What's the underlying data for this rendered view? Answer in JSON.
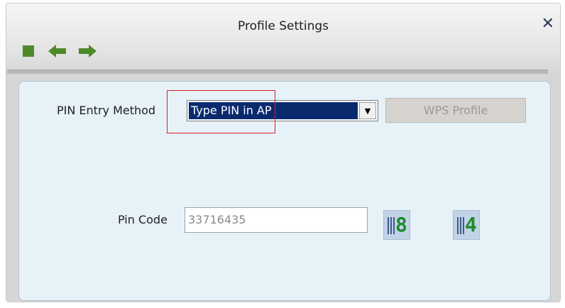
{
  "window": {
    "title": "Profile Settings",
    "close_glyph": "✕"
  },
  "toolbar": {
    "items": [
      {
        "name": "stop-icon",
        "color": "#4f8a2a"
      },
      {
        "name": "back-arrow-icon",
        "color": "#4f8a2a"
      },
      {
        "name": "forward-arrow-icon",
        "color": "#4f8a2a"
      }
    ]
  },
  "form": {
    "pin_entry_label": "PIN Entry Method",
    "pin_entry_value": "Type PIN in AP",
    "wps_profile_button": "WPS Profile",
    "pin_code_label": "Pin Code",
    "pin_code_value": "33716435",
    "pin_icon_1_digit": "8",
    "pin_icon_2_digit": "4"
  },
  "colors": {
    "selection": "#0a2a6e",
    "panel": "#e6f1f8",
    "highlight": "#e02020",
    "icon_green": "#1f8a2c"
  }
}
